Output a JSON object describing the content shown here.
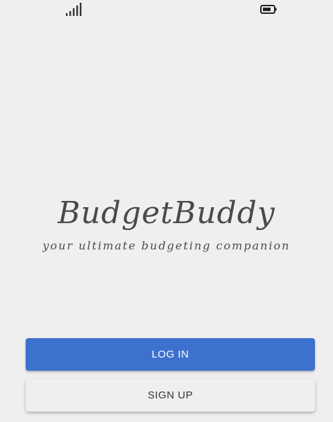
{
  "status_bar": {
    "signal_icon": "signal-bars-icon",
    "battery_icon": "battery-icon"
  },
  "brand": {
    "title": "BudgetBuddy",
    "tagline": "your ultimate budgeting companion"
  },
  "actions": {
    "login_label": "LOG IN",
    "signup_label": "SIGN UP"
  },
  "colors": {
    "background": "#efefef",
    "primary": "#3d71cd",
    "text": "#4a4a4a"
  }
}
